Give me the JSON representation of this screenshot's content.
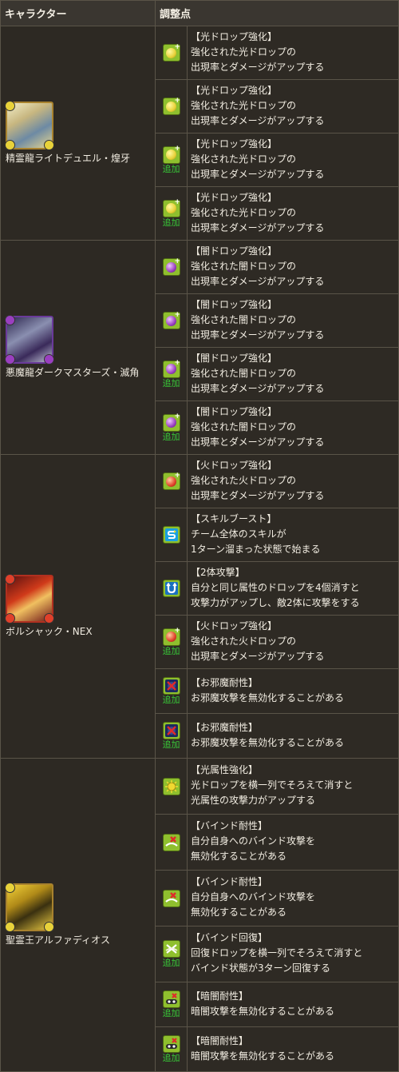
{
  "header": {
    "col_character": "キャラクター",
    "col_changes": "調整点"
  },
  "add_label": "追加",
  "colors": {
    "light": "#e8d23a",
    "dark": "#9a3fc0",
    "fire": "#e0402a",
    "icon_bg": "#8fbf2e",
    "added": "#38c838"
  },
  "groups": [
    {
      "name": "精霊龍ライトデュエル・煌牙",
      "portrait": "light-dragon-portrait",
      "rows": [
        {
          "icon": "light-drop-enhance-icon",
          "added": false,
          "lines": [
            "【光ドロップ強化】",
            "強化された光ドロップの",
            "出現率とダメージがアップする"
          ]
        },
        {
          "icon": "light-drop-enhance-icon",
          "added": false,
          "lines": [
            "【光ドロップ強化】",
            "強化された光ドロップの",
            "出現率とダメージがアップする"
          ]
        },
        {
          "icon": "light-drop-enhance-icon",
          "added": true,
          "lines": [
            "【光ドロップ強化】",
            "強化された光ドロップの",
            "出現率とダメージがアップする"
          ]
        },
        {
          "icon": "light-drop-enhance-icon",
          "added": true,
          "lines": [
            "【光ドロップ強化】",
            "強化された光ドロップの",
            "出現率とダメージがアップする"
          ]
        }
      ]
    },
    {
      "name": "悪魔龍ダークマスターズ・滅角",
      "portrait": "dark-dragon-portrait",
      "rows": [
        {
          "icon": "dark-drop-enhance-icon",
          "added": false,
          "lines": [
            "【闇ドロップ強化】",
            "強化された闇ドロップの",
            "出現率とダメージがアップする"
          ]
        },
        {
          "icon": "dark-drop-enhance-icon",
          "added": false,
          "lines": [
            "【闇ドロップ強化】",
            "強化された闇ドロップの",
            "出現率とダメージがアップする"
          ]
        },
        {
          "icon": "dark-drop-enhance-icon",
          "added": true,
          "lines": [
            "【闇ドロップ強化】",
            "強化された闇ドロップの",
            "出現率とダメージがアップする"
          ]
        },
        {
          "icon": "dark-drop-enhance-icon",
          "added": true,
          "lines": [
            "【闇ドロップ強化】",
            "強化された闇ドロップの",
            "出現率とダメージがアップする"
          ]
        }
      ]
    },
    {
      "name": "ボルシャック・NEX",
      "portrait": "fire-dragon-portrait",
      "rows": [
        {
          "icon": "fire-drop-enhance-icon",
          "added": false,
          "lines": [
            "【火ドロップ強化】",
            "強化された火ドロップの",
            "出現率とダメージがアップする"
          ]
        },
        {
          "icon": "skill-boost-icon",
          "added": false,
          "lines": [
            "【スキルブースト】",
            "チーム全体のスキルが",
            "1ターン溜まった状態で始まる"
          ]
        },
        {
          "icon": "two-pronged-attack-icon",
          "added": false,
          "lines": [
            "【2体攻撃】",
            "自分と同じ属性のドロップを4個消すと",
            "攻撃力がアップし、敵2体に攻撃をする"
          ]
        },
        {
          "icon": "fire-drop-enhance-icon",
          "added": true,
          "lines": [
            "【火ドロップ強化】",
            "強化された火ドロップの",
            "出現率とダメージがアップする"
          ]
        },
        {
          "icon": "jammer-resist-icon",
          "added": true,
          "lines": [
            "【お邪魔耐性】",
            "お邪魔攻撃を無効化することがある"
          ]
        },
        {
          "icon": "jammer-resist-icon",
          "added": true,
          "lines": [
            "【お邪魔耐性】",
            "お邪魔攻撃を無効化することがある"
          ]
        }
      ]
    },
    {
      "name": "聖霊王アルファディオス",
      "portrait": "light-king-portrait",
      "rows": [
        {
          "icon": "light-row-enhance-icon",
          "added": false,
          "lines": [
            "【光属性強化】",
            "光ドロップを横一列でそろえて消すと",
            "光属性の攻撃力がアップする"
          ]
        },
        {
          "icon": "bind-resist-icon",
          "added": false,
          "lines": [
            "【バインド耐性】",
            "自分自身へのバインド攻撃を",
            "無効化することがある"
          ]
        },
        {
          "icon": "bind-resist-icon",
          "added": false,
          "lines": [
            "【バインド耐性】",
            "自分自身へのバインド攻撃を",
            "無効化することがある"
          ]
        },
        {
          "icon": "bind-recovery-icon",
          "added": true,
          "lines": [
            "【バインド回復】",
            "回復ドロップを横一列でそろえて消すと",
            "バインド状態が3ターン回復する"
          ]
        },
        {
          "icon": "blind-resist-icon",
          "added": true,
          "lines": [
            "【暗闇耐性】",
            "暗闇攻撃を無効化することがある"
          ]
        },
        {
          "icon": "blind-resist-icon",
          "added": true,
          "lines": [
            "【暗闇耐性】",
            "暗闇攻撃を無効化することがある"
          ]
        }
      ]
    }
  ]
}
